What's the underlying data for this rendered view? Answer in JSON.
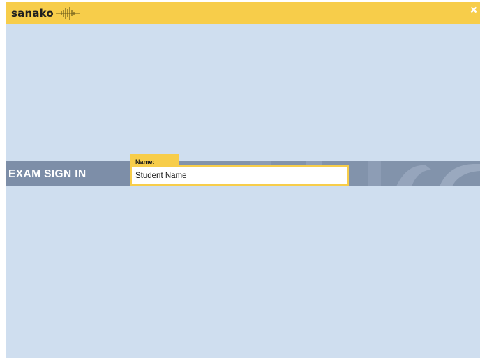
{
  "app": {
    "logo_text": "sanako",
    "logo_icon": "sound-wave-icon",
    "close_icon": "close-icon"
  },
  "signin": {
    "title": "EXAM SIGN IN",
    "name_label": "Name:",
    "name_value": "Student Name"
  },
  "colors": {
    "accent_yellow": "#f7cd4a",
    "background": "#cfdeef",
    "band": "#7d8ea8"
  }
}
